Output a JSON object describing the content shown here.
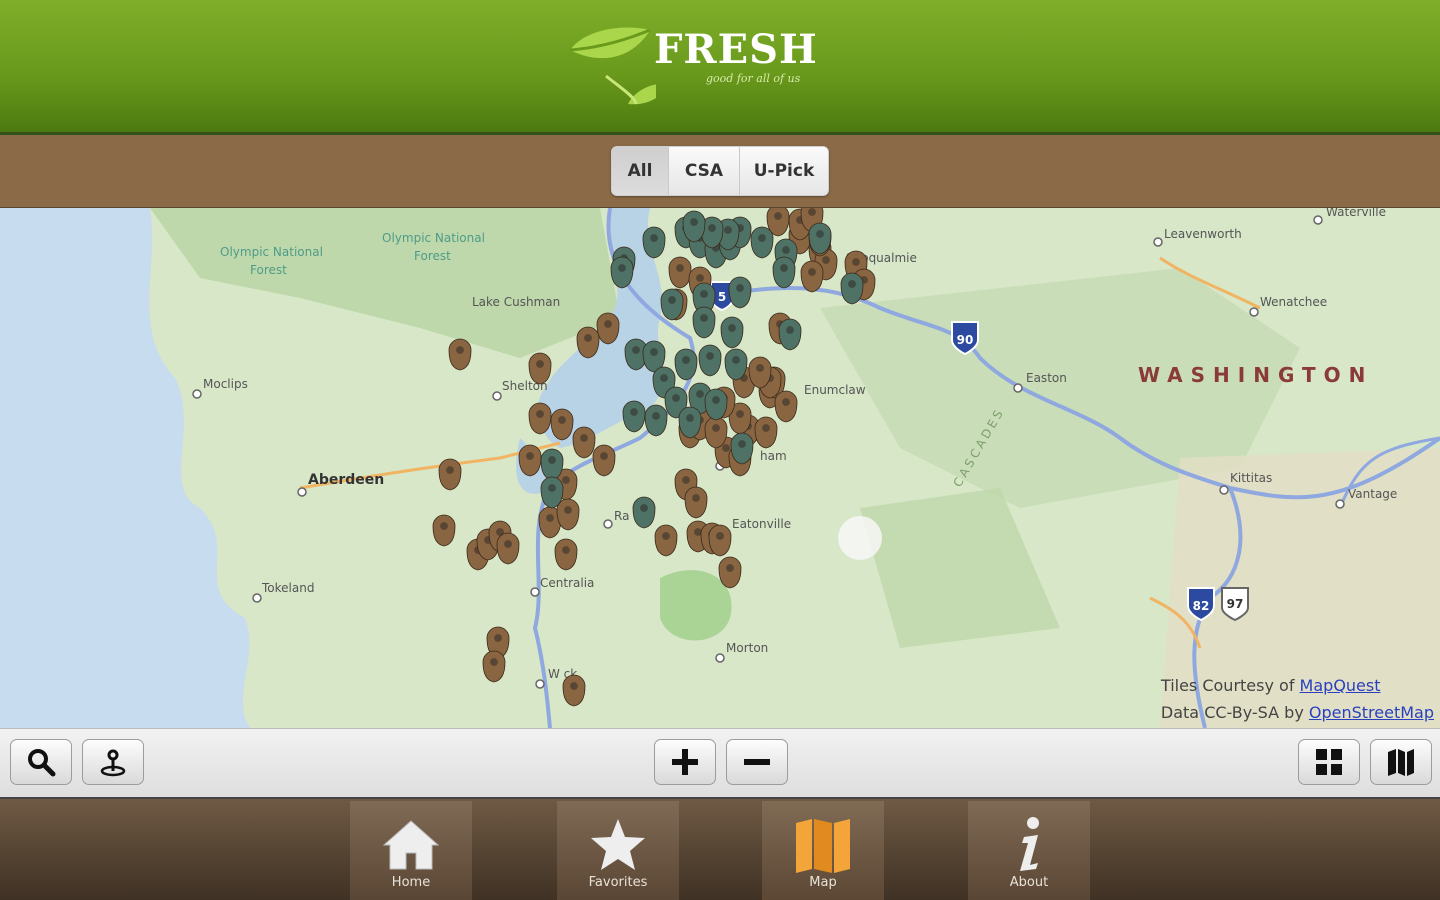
{
  "app": {
    "logo_title": "FRESH",
    "logo_tagline": "good for all of us",
    "brand_green": "#6a9a1c",
    "brand_brown": "#8b6a47"
  },
  "filter": {
    "options": [
      "All",
      "CSA",
      "U-Pick"
    ],
    "selected": "All"
  },
  "map": {
    "labels": {
      "olympic1": "Olympic National",
      "olympic1b": "Forest",
      "olympic2": "Olympic National",
      "olympic2b": "Forest",
      "cushman": "Lake Cushman",
      "moclips": "Moclips",
      "shelton": "Shelton",
      "aberdeen": "Aberdeen",
      "tokeland": "Tokeland",
      "centralia": "Centralia",
      "rainier": "Ra",
      "eatonville": "Eatonville",
      "morton": "Morton",
      "winlock": "W   ck",
      "enumclaw": "Enumclaw",
      "easton": "Easton",
      "snoqualmie": "Snoqualmie",
      "leavenworth": "Leavenworth",
      "waterville": "Waterville",
      "wenatchee": "Wenatchee",
      "washington": "WASHINGTON",
      "kittitas": "Kittitas",
      "vantage": "Vantage",
      "buckley": "ham",
      "cascades": "CASCADES"
    },
    "shields": {
      "i5": "5",
      "i90": "90",
      "i82": "82",
      "us97": "97"
    },
    "attribution": {
      "line1_prefix": "Tiles Courtesy of ",
      "line1_link": "MapQuest",
      "line2_prefix": "Data CC-By-SA by ",
      "line2_link": "OpenStreetMap"
    },
    "marker_colors": {
      "farm": "#8a6541",
      "csa": "#4e7266"
    }
  },
  "toolbar": {
    "search": "search-icon",
    "locate": "locate-icon",
    "zoom_in": "zoom-in-icon",
    "zoom_out": "zoom-out-icon",
    "grid": "grid-icon",
    "map": "map-icon"
  },
  "tabs": [
    {
      "label": "Home",
      "icon": "home-icon"
    },
    {
      "label": "Favorites",
      "icon": "star-icon"
    },
    {
      "label": "Map",
      "icon": "map-icon",
      "active": true
    },
    {
      "label": "About",
      "icon": "info-icon"
    }
  ]
}
